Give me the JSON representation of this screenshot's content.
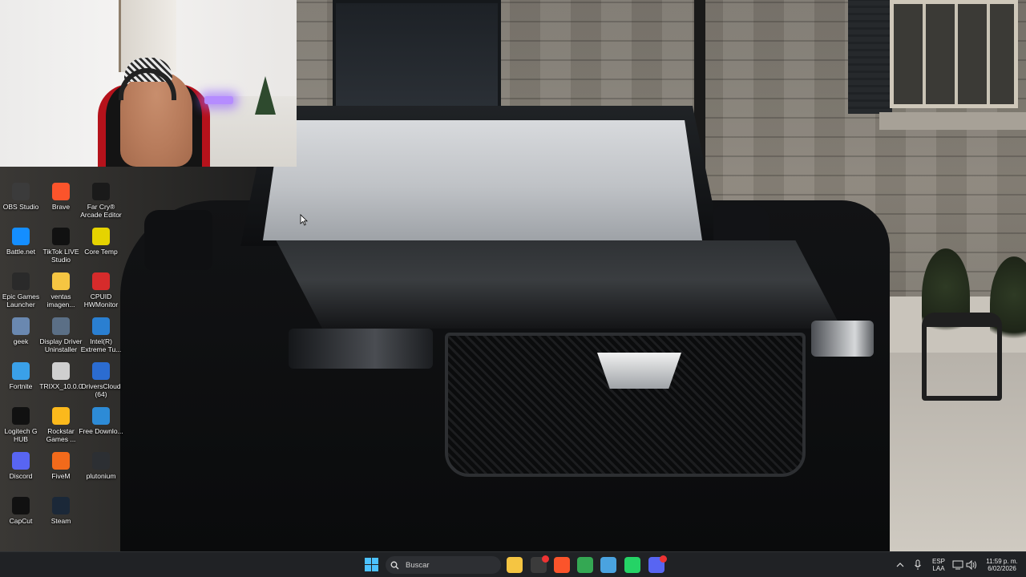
{
  "desktop": {
    "icons": [
      {
        "label": "OBS Studio",
        "icon": "obs-icon",
        "color": "#3b3b3b"
      },
      {
        "label": "Brave",
        "icon": "brave-icon",
        "color": "#fb542b"
      },
      {
        "label": "Far Cry® Arcade Editor",
        "icon": "farcry-icon",
        "color": "#1a1a1a"
      },
      {
        "label": "Battle.net",
        "icon": "battlenet-icon",
        "color": "#148eff"
      },
      {
        "label": "TikTok LIVE Studio",
        "icon": "tiktok-icon",
        "color": "#111111"
      },
      {
        "label": "Core Temp",
        "icon": "coretemp-icon",
        "color": "#e5d300"
      },
      {
        "label": "Epic Games Launcher",
        "icon": "epic-icon",
        "color": "#2a2a2a"
      },
      {
        "label": "ventas imagen...",
        "icon": "folder-icon",
        "color": "#f5c542"
      },
      {
        "label": "CPUID HWMonitor",
        "icon": "hwmonitor-icon",
        "color": "#d62b2b"
      },
      {
        "label": "geek",
        "icon": "geek-icon",
        "color": "#6a88b0"
      },
      {
        "label": "Display Driver Uninstaller",
        "icon": "ddu-icon",
        "color": "#5b6f86"
      },
      {
        "label": "Intel(R) Extreme Tu...",
        "icon": "intel-icon",
        "color": "#2a7fd1"
      },
      {
        "label": "Fortnite",
        "icon": "fortnite-icon",
        "color": "#3aa0e8"
      },
      {
        "label": "TRIXX_10.0.0",
        "icon": "trixx-icon",
        "color": "#cfcfcf"
      },
      {
        "label": "DriversCloud (64)",
        "icon": "driverscloud-icon",
        "color": "#2b6cd1"
      },
      {
        "label": "Logitech G HUB",
        "icon": "logitech-icon",
        "color": "#111111"
      },
      {
        "label": "Rockstar Games ...",
        "icon": "rockstar-icon",
        "color": "#fbb91c"
      },
      {
        "label": "Free Downlo...",
        "icon": "download-icon",
        "color": "#2d8bd6"
      },
      {
        "label": "Discord",
        "icon": "discord-icon",
        "color": "#5865f2"
      },
      {
        "label": "FiveM",
        "icon": "fivem-icon",
        "color": "#f26a1b"
      },
      {
        "label": "plutonium",
        "icon": "plutonium-icon",
        "color": "#2c2f33"
      },
      {
        "label": "CapCut",
        "icon": "capcut-icon",
        "color": "#111111"
      },
      {
        "label": "Steam",
        "icon": "steam-icon",
        "color": "#1b2838"
      }
    ]
  },
  "taskbar": {
    "search_placeholder": "Buscar",
    "apps": [
      {
        "name": "file-explorer-icon",
        "color": "#f5c542"
      },
      {
        "name": "obs-taskbar-icon",
        "color": "#3b3b3b"
      },
      {
        "name": "brave-taskbar-icon",
        "color": "#fb542b"
      },
      {
        "name": "chrome-icon",
        "color": "#34a853"
      },
      {
        "name": "notepad-icon",
        "color": "#4aa3e0"
      },
      {
        "name": "whatsapp-icon",
        "color": "#25d366"
      },
      {
        "name": "discord-taskbar-icon",
        "color": "#5865f2"
      }
    ],
    "tray": {
      "language_line1": "ESP",
      "language_line2": "LAA",
      "time": "11:59 p. m.",
      "date": "6/02/2026"
    }
  }
}
